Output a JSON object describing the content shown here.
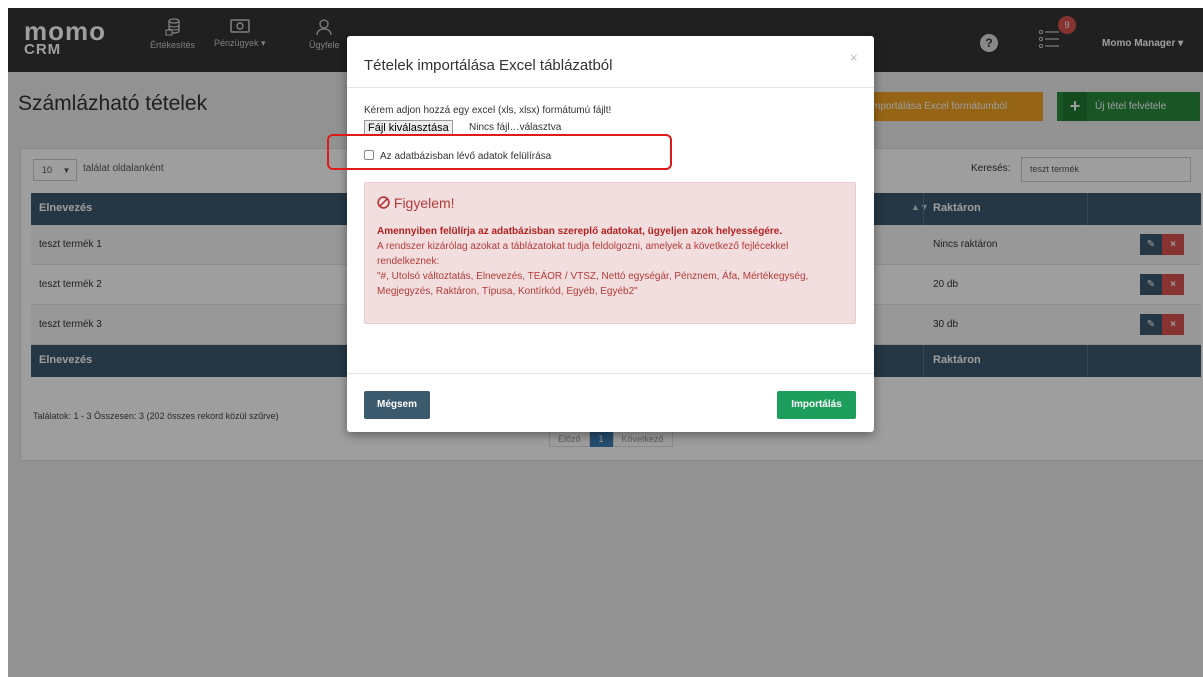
{
  "navbar": {
    "logo_top": "momo",
    "logo_bottom": "CRM",
    "items": [
      {
        "label": "Értékesítés",
        "icon": "coins-icon"
      },
      {
        "label": "Pénzügyek ▾",
        "icon": "banknote-icon"
      },
      {
        "label": "Ügyfele",
        "icon": "user-icon"
      }
    ],
    "help": "?",
    "notification_count": "9",
    "user": "Momo Manager ▾"
  },
  "page": {
    "title": "Számlázható tételek",
    "import_button": "mportálása Excel formátumból",
    "new_item_button": "Új tétel felvétele"
  },
  "table": {
    "page_length": "10",
    "page_length_label": "találat oldalanként",
    "search_label": "Keresés:",
    "search_value": "teszt termék",
    "columns": [
      "Elnevezés",
      "Raktáron"
    ],
    "rows": [
      {
        "name": "teszt termék 1",
        "stock": "Nincs raktáron"
      },
      {
        "name": "teszt termék 2",
        "stock": "20 db"
      },
      {
        "name": "teszt termék 3",
        "stock": "30 db"
      }
    ],
    "info": "Találatok: 1 - 3 Összesen: 3 (202 összes rekord közül szűrve)",
    "pager": {
      "prev": "Előző",
      "current": "1",
      "next": "Következő"
    }
  },
  "modal": {
    "title": "Tételek importálása Excel táblázatból",
    "close": "×",
    "instruction": "Kérem adjon hozzá egy excel (xls, xlsx) formátumú fájlt!",
    "file_button": "Fájl kiválasztása",
    "file_none": "Nincs fájl…választva",
    "overwrite_label": "Az adatbázisban lévő adatok felülírása",
    "alert": {
      "title": "Figyelem!",
      "bold": "Amennyiben felülírja az adatbázisban szereplő adatokat, ügyeljen azok helyességére.",
      "text": "A rendszer kizárólag azokat a táblázatokat tudja feldolgozni, amelyek a következő fejlécekkel rendelkeznek:",
      "headers": "\"#, Utolsó változtatás, Elnevezés, TEÁOR / VTSZ, Nettó egységár, Pénznem, Áfa, Mértékegység, Megjegyzés, Raktáron, Típusa, Kontírkód, Egyéb, Egyéb2\""
    },
    "cancel": "Mégsem",
    "import": "Importálás"
  },
  "colors": {
    "navbar": "#343434",
    "table_header": "#3c5a6e",
    "orange": "#f0a323",
    "green": "#1e9e5c",
    "danger": "#d9534f",
    "highlight": "#e0191c"
  }
}
